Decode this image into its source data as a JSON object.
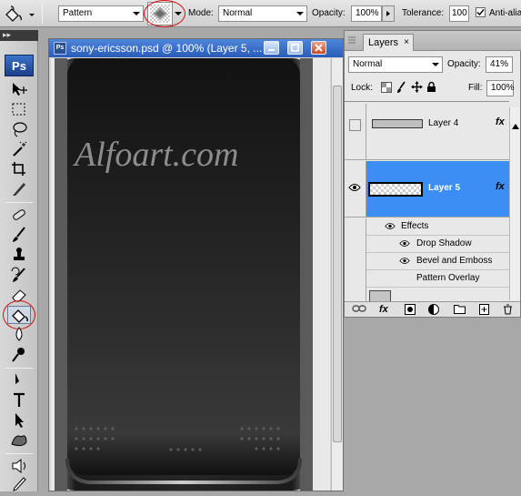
{
  "options_bar": {
    "fill_source": "Pattern",
    "mode_label": "Mode:",
    "mode_value": "Normal",
    "opacity_label": "Opacity:",
    "opacity_value": "100%",
    "tolerance_label": "Tolerance:",
    "tolerance_value": "100",
    "anti_alias_label": "Anti-alia",
    "anti_alias_checked": true
  },
  "toolbox": {
    "grip_label": "▸▸",
    "logo": "Ps",
    "active_tool": "paint-bucket",
    "tools": [
      "move",
      "marquee",
      "lasso",
      "magic-wand",
      "crop",
      "slice",
      "healing-brush",
      "brush",
      "clone-stamp",
      "history-brush",
      "eraser",
      "paint-bucket",
      "blur",
      "dodge",
      "pen",
      "type",
      "path-selection",
      "custom-shape",
      "notes",
      "eyedropper"
    ]
  },
  "document": {
    "title": "sony-ericsson.psd @ 100% (Layer 5, ...",
    "icon_text": "Ps",
    "watermark": "Alfoart.com"
  },
  "layers_panel": {
    "tab_label": "Layers",
    "tab_close": "×",
    "blend_mode": "Normal",
    "opacity_label": "Opacity:",
    "opacity_value": "41%",
    "lock_label": "Lock:",
    "fill_label": "Fill:",
    "fill_value": "100%",
    "fx_glyph": "fx",
    "layers": [
      {
        "name": "Layer 4",
        "selected": false,
        "visible": false
      },
      {
        "name": "Layer 5",
        "selected": true,
        "visible": true
      }
    ],
    "effects_label": "Effects",
    "effects": [
      {
        "name": "Drop Shadow",
        "visible": true
      },
      {
        "name": "Bevel and Emboss",
        "visible": true
      },
      {
        "name": "Pattern Overlay",
        "visible": false
      }
    ]
  },
  "colors": {
    "selected_layer": "#3b8ff4",
    "title_bar": "#2a5bb8",
    "annotation": "#d01010"
  }
}
